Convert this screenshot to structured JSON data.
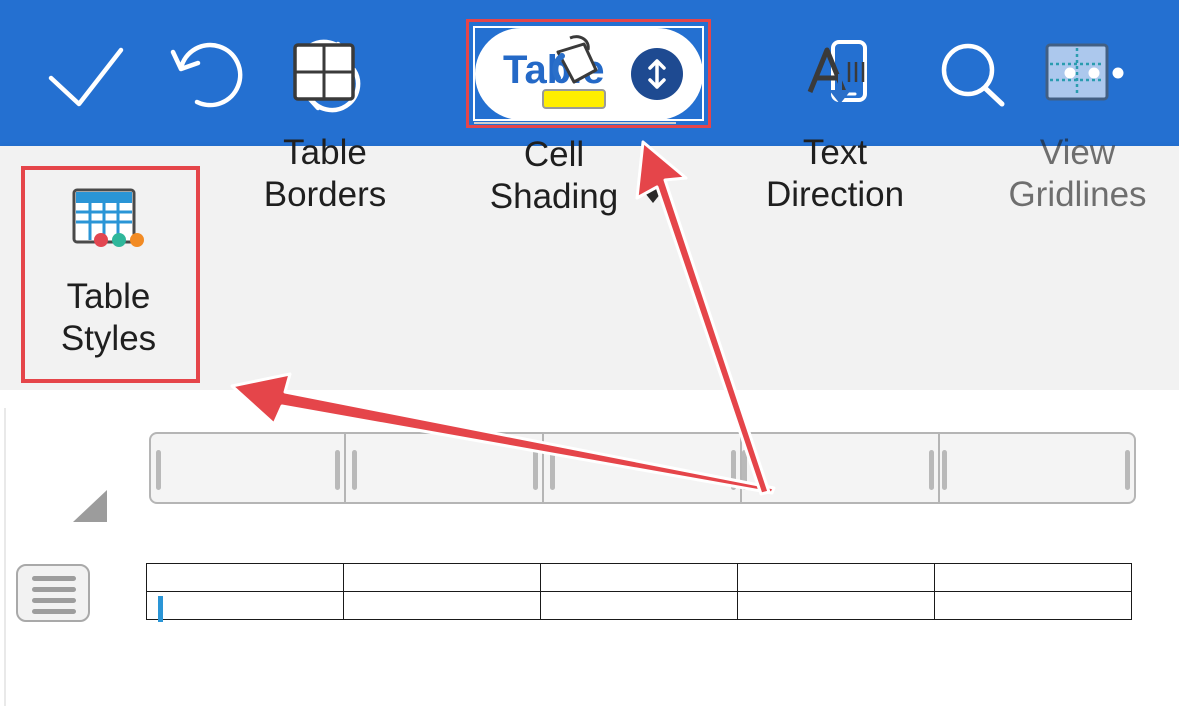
{
  "toolbar": {
    "left_icons": [
      "checkmark-icon",
      "undo-icon",
      "sync-icon"
    ],
    "right_icons": [
      "phone-view-icon",
      "search-icon",
      "more-icon"
    ],
    "mode_selector": {
      "label": "Table",
      "icon": "expand-collapse-icon"
    }
  },
  "ribbon": {
    "items": [
      {
        "line1": "Table",
        "line2": "Styles",
        "icon": "table-styles-icon",
        "highlighted": true
      },
      {
        "line1": "Table",
        "line2": "Borders",
        "icon": "table-borders-icon"
      },
      {
        "line1": "Cell",
        "line2": "Shading",
        "icon": "paint-bucket-icon",
        "dropdown": true
      },
      {
        "line1": "Text",
        "line2": "Direction",
        "icon": "text-direction-icon"
      },
      {
        "line1": "View",
        "line2": "Gridlines",
        "icon": "view-gridlines-icon"
      }
    ]
  },
  "document": {
    "table": {
      "rows": 2,
      "columns": 5
    }
  },
  "colors": {
    "toolbar_bg": "#2470d1",
    "accent_blue": "#2469c7",
    "highlight_red": "#e5454a",
    "shading_yellow": "#ffee00"
  }
}
